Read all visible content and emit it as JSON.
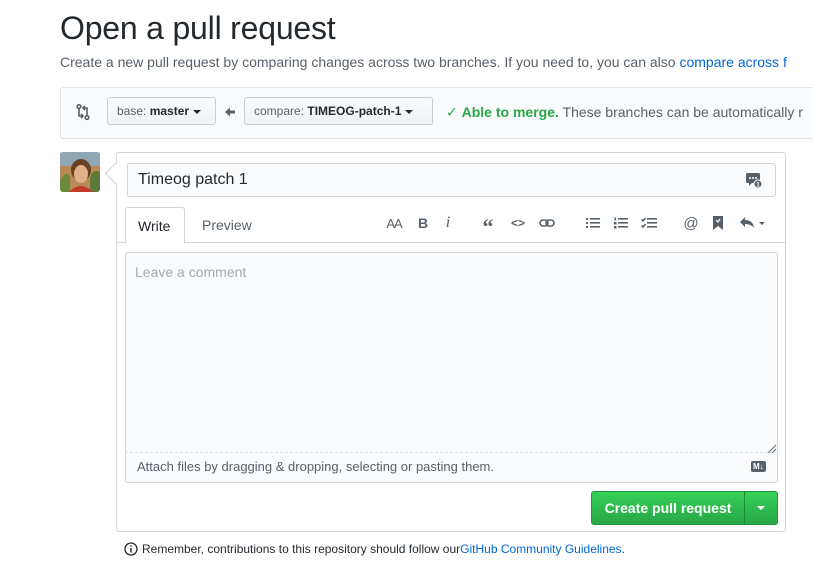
{
  "header": {
    "title": "Open a pull request",
    "subtitle_text": "Create a new pull request by comparing changes across two branches. If you need to, you can also ",
    "subtitle_link": "compare across f"
  },
  "range": {
    "base_prefix": "base:",
    "base_branch": "master",
    "compare_prefix": "compare:",
    "compare_branch": "TIMEOG-patch-1",
    "merge_status": "Able to merge.",
    "merge_detail": " These branches can be automatically r"
  },
  "form": {
    "title_value": "Timeog patch 1",
    "tabs": [
      "Write",
      "Preview"
    ],
    "comment_placeholder": "Leave a comment",
    "attach_text": "Attach files by dragging & dropping, selecting or pasting them.",
    "md_badge": "M↓",
    "create_label": "Create pull request"
  },
  "toolbar": {
    "heading": "AA",
    "bold": "B",
    "italic": "i",
    "quote": "“",
    "code": "<>",
    "mention": "@"
  },
  "footer": {
    "text": "Remember, contributions to this repository should follow our ",
    "link": "GitHub Community Guidelines",
    "end": "."
  },
  "colors": {
    "link": "#0366d6",
    "success": "#28a745",
    "button_green": "#2cbe4e"
  }
}
